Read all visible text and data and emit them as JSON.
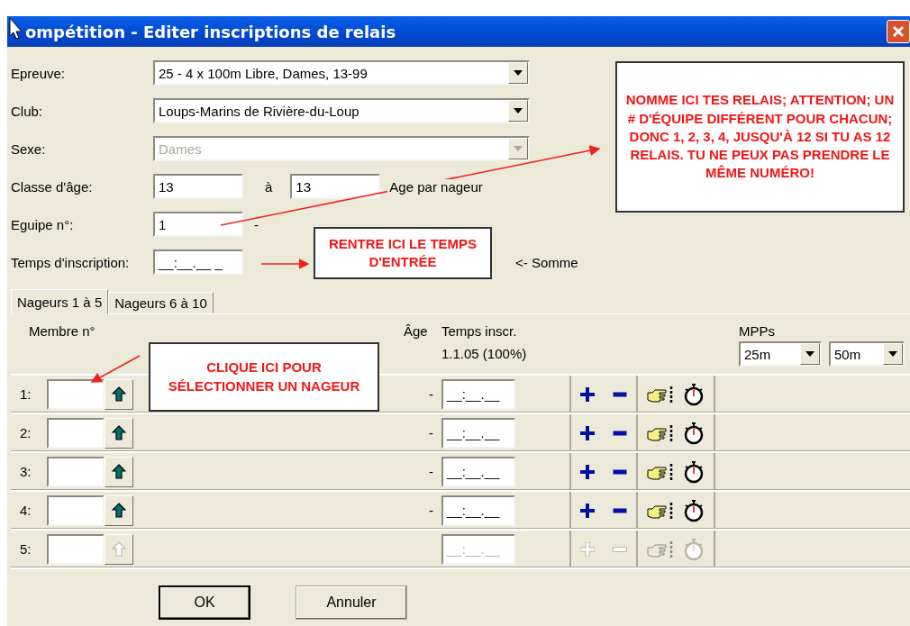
{
  "window": {
    "title": "ompétition - Editer inscriptions de relais"
  },
  "form": {
    "event": {
      "label": "Epreuve:",
      "value": "25 - 4 x 100m Libre, Dames, 13-99",
      "disabled": false
    },
    "club": {
      "label": "Club:",
      "value": "Loups-Marins de Rivière-du-Loup",
      "disabled": false
    },
    "sex": {
      "label": "Sexe:",
      "value": "Dames",
      "disabled": true
    },
    "age_class": {
      "label": "Classe d'âge:",
      "from": "13",
      "to_label": "à",
      "to": "13",
      "note": "Age par nageur"
    },
    "team": {
      "label": "Eguipe n°:",
      "value": "1",
      "suffix": "-"
    },
    "entry_time": {
      "label": "Temps d'inscription:",
      "value": "__:__.__ _",
      "note": "<- Somme"
    }
  },
  "tabs": [
    {
      "label": "Nageurs 1 à 5",
      "selected": true
    },
    {
      "label": "Nageurs 6 à 10",
      "selected": false
    }
  ],
  "table": {
    "member_header": "Membre n°",
    "age_header": "Âge",
    "time_header": "Temps inscr.",
    "time_subheader": "1.1.05 (100%)",
    "mpps_label": "MPPs",
    "mpp_selects": [
      "25m",
      "50m"
    ],
    "rows": [
      {
        "number": "1:",
        "age": "-",
        "time": "__:__.__",
        "disabled": false
      },
      {
        "number": "2:",
        "age": "-",
        "time": "__:__.__",
        "disabled": false
      },
      {
        "number": "3:",
        "age": "-",
        "time": "__:__.__",
        "disabled": false
      },
      {
        "number": "4:",
        "age": "-",
        "time": "__:__.__",
        "disabled": false
      },
      {
        "number": "5:",
        "time": "__:__.__",
        "disabled": true
      }
    ]
  },
  "buttons": [
    {
      "label": "OK",
      "default": true
    },
    {
      "label": "Annuler",
      "default": false
    }
  ],
  "annotations": [
    {
      "kind": "team",
      "text": "NOMME ICI TES RELAIS; ATTENTION; UN # D'ÉQUIPE DIFFÉRENT POUR CHACUN; DONC 1, 2, 3, 4, JUSQU'À 12 SI TU AS 12 RELAIS. TU NE PEUX PAS PRENDRE LE MÊME NUMÉRO!"
    },
    {
      "kind": "time",
      "text": "RENTRE ICI LE TEMPS D'ENTRÉE"
    },
    {
      "kind": "member",
      "text": "CLIQUE ICI POUR SÉLECTIONNER UN NAGEUR"
    }
  ]
}
